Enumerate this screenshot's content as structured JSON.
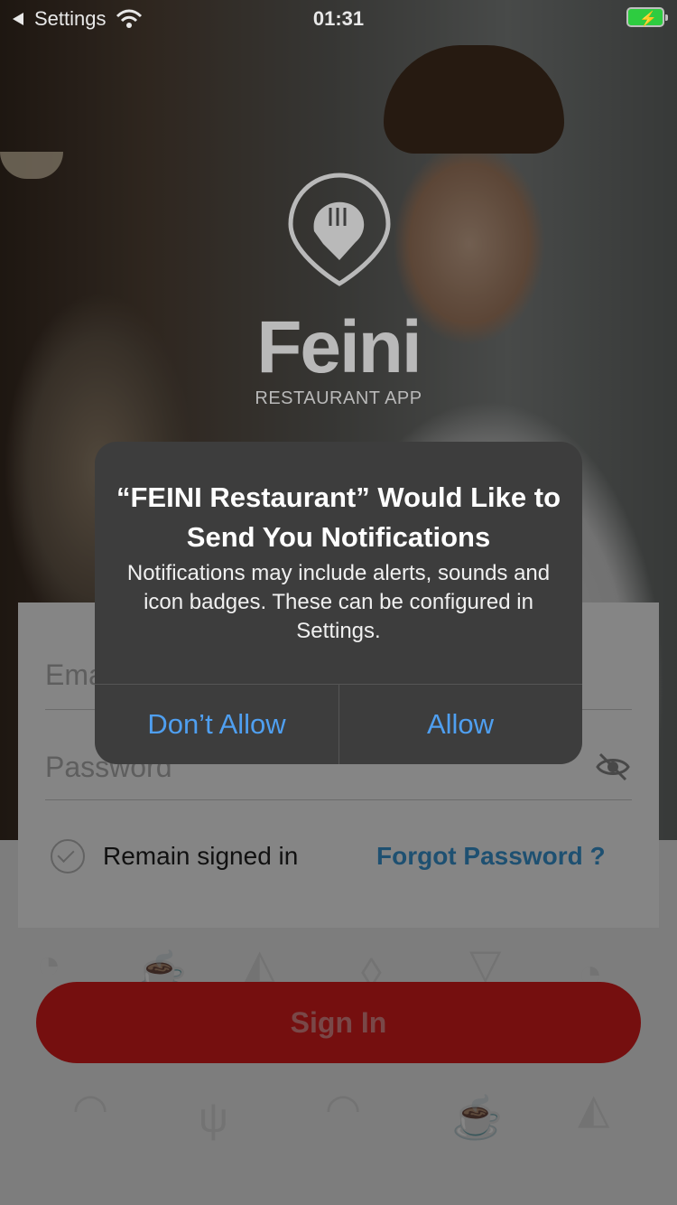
{
  "status_bar": {
    "back_app": "Settings",
    "time": "01:31",
    "battery_icon": "battery-charging-icon",
    "wifi_icon": "wifi-icon"
  },
  "brand": {
    "logo_icon": "pin-fork-icon",
    "name": "Feini",
    "subtitle": "RESTAURANT APP"
  },
  "login": {
    "email_placeholder": "Email",
    "password_placeholder": "Password",
    "remain_signed_in": "Remain signed in",
    "forgot_password": "Forgot Password ?",
    "sign_in": "Sign In"
  },
  "alert": {
    "title": "“FEINI Restaurant” Would Like to Send You Notifications",
    "message": "Notifications may include alerts, sounds and icon badges. These can be configured in Settings.",
    "deny": "Don’t Allow",
    "allow": "Allow"
  },
  "colors": {
    "primary_red": "#e01d1d",
    "link_blue": "#3b9ad9",
    "alert_button_blue": "#4f9ff0",
    "alert_bg": "#3d3d3d"
  }
}
